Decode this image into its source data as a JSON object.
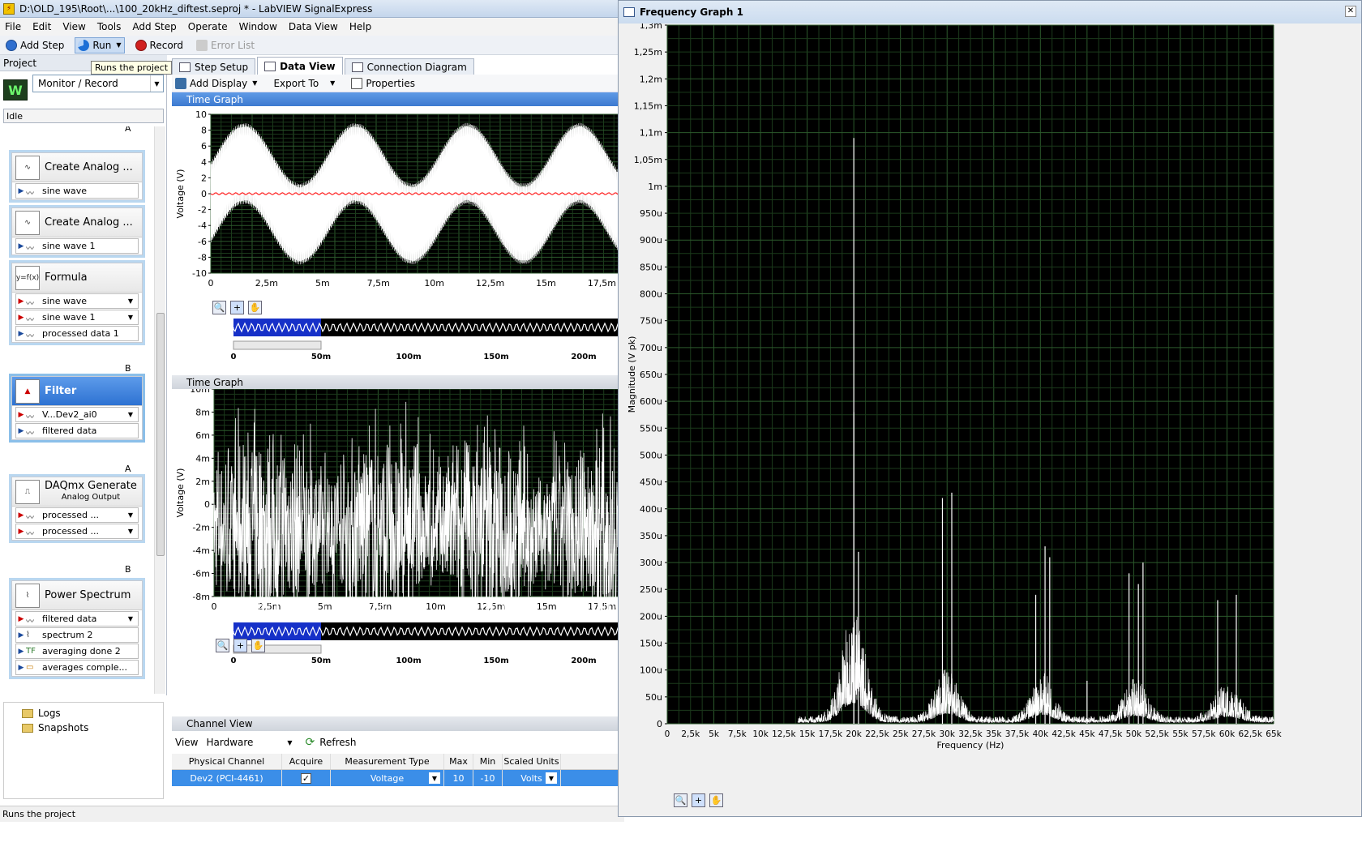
{
  "window": {
    "title": "D:\\OLD_195\\Root\\...\\100_20kHz_diftest.seproj * - LabVIEW SignalExpress"
  },
  "menu": [
    "File",
    "Edit",
    "View",
    "Tools",
    "Add Step",
    "Operate",
    "Window",
    "Data View",
    "Help"
  ],
  "toolbar": {
    "add_step": "Add Step",
    "run": "Run",
    "record": "Record",
    "error_list": "Error List"
  },
  "tooltip": "Runs the project",
  "project": {
    "label": "Project",
    "mode": "Monitor / Record",
    "status": "Idle"
  },
  "steps": [
    {
      "name": "Create Analog ...",
      "rows": [
        {
          "label": "sine wave",
          "dir": "out"
        }
      ]
    },
    {
      "name": "Create Analog ...",
      "rows": [
        {
          "label": "sine wave 1",
          "dir": "out"
        }
      ]
    },
    {
      "name": "Formula",
      "rows": [
        {
          "label": "sine wave",
          "dir": "in"
        },
        {
          "label": "sine wave 1",
          "dir": "in"
        },
        {
          "label": "processed data 1",
          "dir": "out"
        }
      ]
    },
    {
      "name": "Filter",
      "rows": [
        {
          "label": "V...Dev2_ai0",
          "dir": "in"
        },
        {
          "label": "filtered data",
          "dir": "out"
        }
      ]
    },
    {
      "name": "DAQmx Generate",
      "sub": "Analog Output",
      "rows": [
        {
          "label": "processed ...",
          "dir": "in"
        },
        {
          "label": "processed ...",
          "dir": "in"
        }
      ]
    },
    {
      "name": "Power Spectrum",
      "rows": [
        {
          "label": "filtered data",
          "dir": "in"
        },
        {
          "label": "spectrum 2",
          "dir": "out"
        },
        {
          "label": "averaging done 2",
          "dir": "out"
        },
        {
          "label": "averages comple...",
          "dir": "out"
        }
      ]
    }
  ],
  "step_markers": {
    "a": "A",
    "b": "B"
  },
  "logs": [
    "Logs",
    "Snapshots"
  ],
  "statusbar": "Runs the project",
  "tabs": [
    "Step Setup",
    "Data View",
    "Connection Diagram"
  ],
  "dataview": {
    "add_display": "Add Display",
    "export_to": "Export To",
    "properties": "Properties"
  },
  "graph1": {
    "title": "Time Graph",
    "ylabel": "Voltage (V)",
    "yticks": [
      "10",
      "8",
      "6",
      "4",
      "2",
      "0",
      "-2",
      "-4",
      "-6",
      "-8",
      "-10"
    ],
    "xticks": [
      "0",
      "2,5m",
      "5m",
      "7,5m",
      "10m",
      "12,5m",
      "15m",
      "17,5m"
    ],
    "overview_ticks": [
      "0",
      "50m",
      "100m",
      "150m",
      "200m"
    ]
  },
  "graph2": {
    "title": "Time Graph",
    "ylabel": "Voltage (V)",
    "yticks": [
      "10m",
      "8m",
      "6m",
      "4m",
      "2m",
      "0",
      "-2m",
      "-4m",
      "-6m",
      "-8m"
    ],
    "xticks": [
      "0",
      "2,5m",
      "5m",
      "7,5m",
      "10m",
      "12,5m",
      "15m",
      "17,5m"
    ],
    "overview_ticks": [
      "0",
      "50m",
      "100m",
      "150m",
      "200m"
    ]
  },
  "channel_view": {
    "title": "Channel View",
    "view_label": "View",
    "view_value": "Hardware",
    "refresh": "Refresh",
    "headers": [
      "Physical Channel",
      "Acquire",
      "Measurement Type",
      "Max",
      "Min",
      "Scaled Units"
    ],
    "row": {
      "channel": "Dev2 (PCI-4461)",
      "acquire": "✓",
      "type": "Voltage",
      "max": "10",
      "min": "-10",
      "units": "Volts"
    }
  },
  "frequency": {
    "title": "Frequency Graph 1",
    "ylabel": "Magnitude (V pk)",
    "xlabel": "Frequency (Hz)",
    "yticks": [
      "1,3m",
      "1,25m",
      "1,2m",
      "1,15m",
      "1,1m",
      "1,05m",
      "1m",
      "950u",
      "900u",
      "850u",
      "800u",
      "750u",
      "700u",
      "650u",
      "600u",
      "550u",
      "500u",
      "450u",
      "400u",
      "350u",
      "300u",
      "250u",
      "200u",
      "150u",
      "100u",
      "50u",
      "0"
    ],
    "xticks": [
      "0",
      "2,5k",
      "5k",
      "7,5k",
      "10k",
      "12,5k",
      "15k",
      "17,5k",
      "20k",
      "22,5k",
      "25k",
      "27,5k",
      "30k",
      "32,5k",
      "35k",
      "37,5k",
      "40k",
      "42,5k",
      "45k",
      "47,5k",
      "50k",
      "52,5k",
      "55k",
      "57,5k",
      "60k",
      "62,5k",
      "65k"
    ]
  },
  "chart_data": [
    {
      "type": "line",
      "title": "Frequency Graph 1",
      "xlabel": "Frequency (Hz)",
      "ylabel": "Magnitude (V pk)",
      "xlim": [
        0,
        65000
      ],
      "ylim": [
        0,
        0.0013
      ],
      "grid": true,
      "peaks": [
        {
          "x": 20000,
          "y": 0.00109
        },
        {
          "x": 20000,
          "y": 0.00058
        },
        {
          "x": 20500,
          "y": 0.00032
        },
        {
          "x": 29500,
          "y": 0.00042
        },
        {
          "x": 30500,
          "y": 0.00043
        },
        {
          "x": 39500,
          "y": 0.00024
        },
        {
          "x": 40500,
          "y": 0.00033
        },
        {
          "x": 41000,
          "y": 0.00031
        },
        {
          "x": 45000,
          "y": 8e-05
        },
        {
          "x": 49500,
          "y": 0.00028
        },
        {
          "x": 50500,
          "y": 0.00026
        },
        {
          "x": 51000,
          "y": 0.0003
        },
        {
          "x": 59000,
          "y": 0.00023
        },
        {
          "x": 61000,
          "y": 0.00024
        }
      ]
    },
    {
      "type": "line",
      "title": "Time Graph",
      "ylabel": "Voltage (V)",
      "xlim": [
        0,
        0.0185
      ],
      "ylim": [
        -10,
        10
      ],
      "grid": true
    },
    {
      "type": "line",
      "title": "Time Graph",
      "ylabel": "Voltage (V)",
      "xlim": [
        0,
        0.0185
      ],
      "ylim": [
        -0.008,
        0.01
      ],
      "grid": true
    }
  ]
}
